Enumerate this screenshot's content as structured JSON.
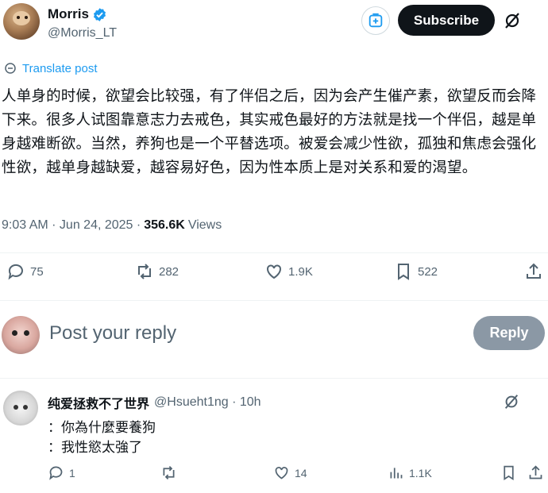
{
  "author": {
    "name": "Morris",
    "handle": "@Morris_LT"
  },
  "header": {
    "subscribe_label": "Subscribe"
  },
  "post": {
    "translate_label": "Translate post",
    "text": "人单身的时候，欲望会比较强，有了伴侣之后，因为会产生催产素，欲望反而会降下来。很多人试图靠意志力去戒色，其实戒色最好的方法就是找一个伴侣，越是单身越难断欲。当然，养狗也是一个平替选项。被爱会减少性欲，孤独和焦虑会强化性欲，越单身越缺爱，越容易好色，因为性本质上是对关系和爱的渴望。",
    "time": "9:03 AM · Jun 24, 2025 ·",
    "views_count": "356.6K",
    "views_label": "Views"
  },
  "actions": {
    "replies": "75",
    "reposts": "282",
    "likes": "1.9K",
    "bookmarks": "522"
  },
  "reply_box": {
    "placeholder": "Post your reply",
    "button_label": "Reply"
  },
  "comment": {
    "name": "纯爱拯救不了世界",
    "handle": "@Hsueht1ng · 10h",
    "line1": "：你為什麼要養狗",
    "line2": "：我性慾太強了",
    "replies": "1",
    "likes": "14",
    "views": "1.1K"
  },
  "colors": {
    "accent": "#1d9bf0",
    "text": "#0f1419",
    "muted": "#536471",
    "reply_button": "#8b98a5"
  }
}
